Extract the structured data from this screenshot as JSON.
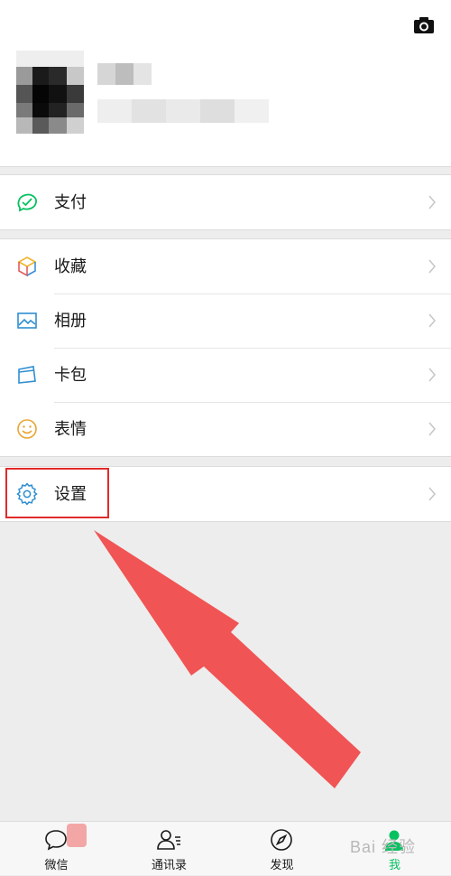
{
  "colors": {
    "accent": "#07c160",
    "highlight": "#e22b2b",
    "arrow": "#f15454"
  },
  "header": {
    "camera_icon": "camera-icon"
  },
  "menu": {
    "pay": {
      "label": "支付",
      "icon": "wallet-icon"
    },
    "favorites": {
      "label": "收藏",
      "icon": "cube-icon"
    },
    "album": {
      "label": "相册",
      "icon": "image-icon"
    },
    "cards": {
      "label": "卡包",
      "icon": "card-icon"
    },
    "stickers": {
      "label": "表情",
      "icon": "smile-icon"
    },
    "settings": {
      "label": "设置",
      "icon": "gear-icon"
    }
  },
  "tabbar": {
    "tabs": [
      {
        "label": "微信",
        "icon": "chat-icon"
      },
      {
        "label": "通讯录",
        "icon": "contacts-icon"
      },
      {
        "label": "发现",
        "icon": "compass-icon"
      },
      {
        "label": "我",
        "icon": "person-icon",
        "active": true
      }
    ]
  },
  "watermark": {
    "text": "Bai 经验"
  }
}
